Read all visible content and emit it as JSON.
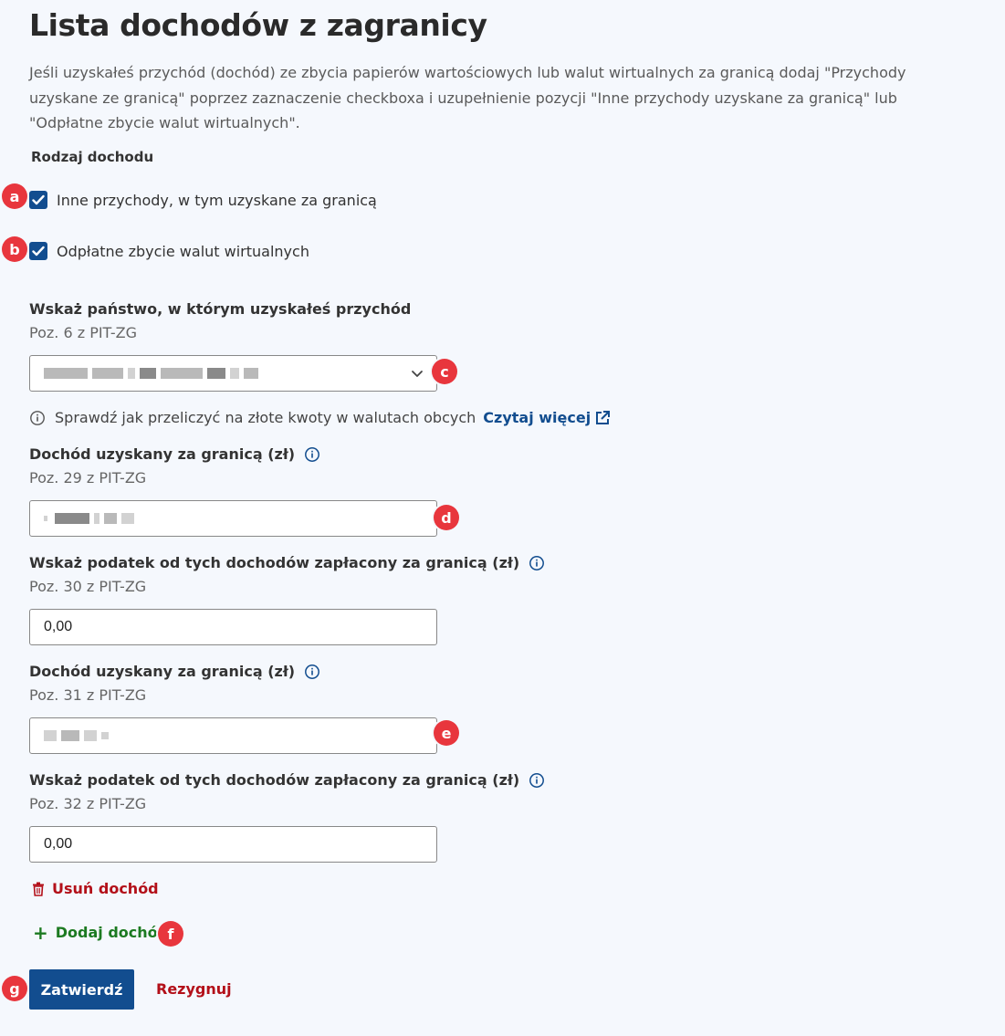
{
  "page": {
    "title": "Lista dochodów z zagranicy",
    "intro": "Jeśli uzyskałeś przychód (dochód) ze zbycia papierów wartościowych lub walut wirtualnych za granicą dodaj \"Przychody uzyskane ze granicą\" poprzez zaznaczenie checkboxa i uzupełnienie pozycji \"Inne przychody uzyskane za granicą\" lub \"Odpłatne zbycie walut wirtualnych\"."
  },
  "income_type": {
    "label": "Rodzaj dochodu",
    "options": [
      {
        "label": "Inne przychody, w tym uzyskane za granicą",
        "checked": true,
        "marker": "a"
      },
      {
        "label": "Odpłatne zbycie walut wirtualnych",
        "checked": true,
        "marker": "b"
      }
    ]
  },
  "country": {
    "label": "Wskaż państwo, w którym uzyskałeś przychód",
    "sub": "Poz. 6 z PIT-ZG",
    "value_redacted": true,
    "marker": "c"
  },
  "hint": {
    "text": "Sprawdź jak przeliczyć na złote kwoty w walutach obcych",
    "link": "Czytaj więcej"
  },
  "fields": [
    {
      "label": "Dochód uzyskany za granicą (zł)",
      "sub": "Poz. 29 z PIT-ZG",
      "value": "",
      "redacted": true,
      "marker": "d"
    },
    {
      "label": "Wskaż podatek od tych dochodów zapłacony za granicą (zł)",
      "sub": "Poz. 30 z PIT-ZG",
      "value": "0,00"
    },
    {
      "label": "Dochód uzyskany za granicą (zł)",
      "sub": "Poz. 31 z PIT-ZG",
      "value": "",
      "redacted": true,
      "marker": "e"
    },
    {
      "label": "Wskaż podatek od tych dochodów zapłacony za granicą (zł)",
      "sub": "Poz. 32 z PIT-ZG",
      "value": "0,00"
    }
  ],
  "actions": {
    "remove": "Usuń dochód",
    "add": "Dodaj dochód",
    "add_marker": "f",
    "submit": "Zatwierdź",
    "submit_marker": "g",
    "cancel": "Rezygnuj"
  },
  "colors": {
    "primary": "#124d8f",
    "danger": "#b31019",
    "success": "#1c7a21",
    "marker": "#e8363d",
    "background": "#f5f8fd"
  },
  "icons": {
    "checkbox": "checkmark-icon",
    "select": "chevron-down-icon",
    "info": "info-circle-icon",
    "external": "external-link-icon",
    "remove": "trash-icon",
    "add": "plus-icon"
  }
}
